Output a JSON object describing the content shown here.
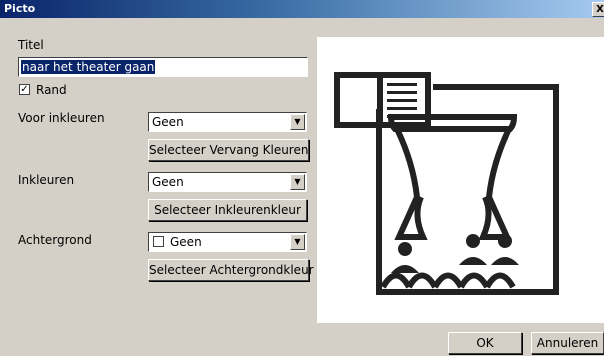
{
  "window": {
    "title": "Picto",
    "close_label": "X"
  },
  "form": {
    "title_label": "Titel",
    "title_value": "naar het theater gaan",
    "border_label": "Rand",
    "border_checked": true,
    "pre_color_label": "Voor inkleuren",
    "pre_color_value": "Geen",
    "replace_colors_button": "Selecteer Vervang Kleuren",
    "color_label": "Inkleuren",
    "color_value": "Geen",
    "color_button": "Selecteer Inkleurenkleur",
    "background_label": "Achtergrond",
    "background_value": "Geen",
    "background_button": "Selecteer Achtergrondkleur"
  },
  "pictogram": {
    "icon": "theater-stage-icon",
    "color": "#222222"
  },
  "footer": {
    "ok_label": "OK",
    "cancel_label": "Annuleren"
  }
}
